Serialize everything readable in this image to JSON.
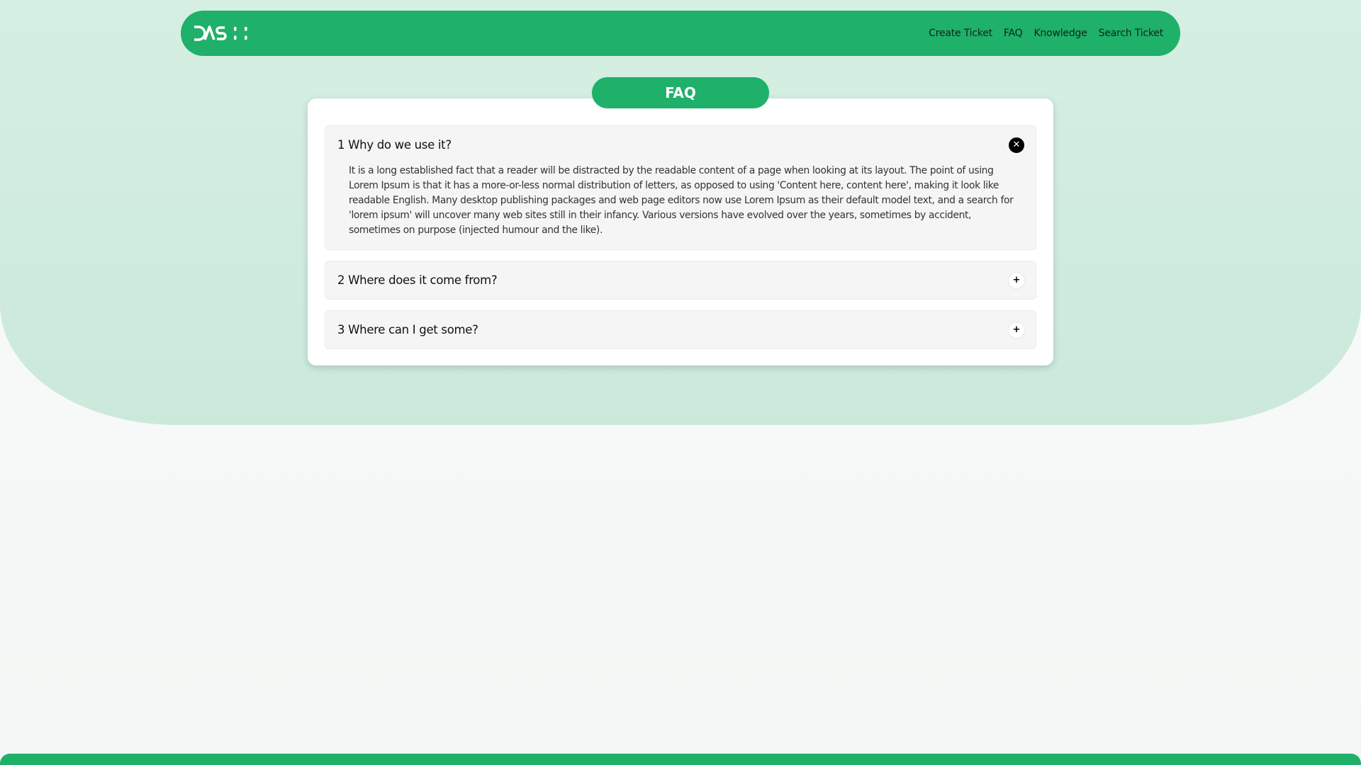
{
  "brand": {
    "logo_text": "DASH"
  },
  "nav": {
    "links": [
      "Create Ticket",
      "FAQ",
      "Knowledge",
      "Search Ticket"
    ]
  },
  "faq": {
    "heading": "FAQ",
    "items": [
      {
        "question": "1 Why do we use it?",
        "expanded": true,
        "toggle_icon": "close-icon",
        "answer": "It is a long established fact that a reader will be distracted by the readable content of a page when looking at its layout. The point of using Lorem Ipsum is that it has a more-or-less normal distribution of letters, as opposed to using 'Content here, content here', making it look like readable English. Many desktop publishing packages and web page editors now use Lorem Ipsum as their default model text, and a search for 'lorem ipsum' will uncover many web sites still in their infancy. Various versions have evolved over the years, sometimes by accident, sometimes on purpose (injected humour and the like)."
      },
      {
        "question": "2 Where does it come from?",
        "expanded": false,
        "toggle_icon": "plus-icon"
      },
      {
        "question": "3 Where can I get some?",
        "expanded": false,
        "toggle_icon": "plus-icon"
      }
    ]
  },
  "colors": {
    "brand_green": "#1fb06a",
    "hero_background": "#d3eddf",
    "page_background": "#f7f9f8"
  }
}
